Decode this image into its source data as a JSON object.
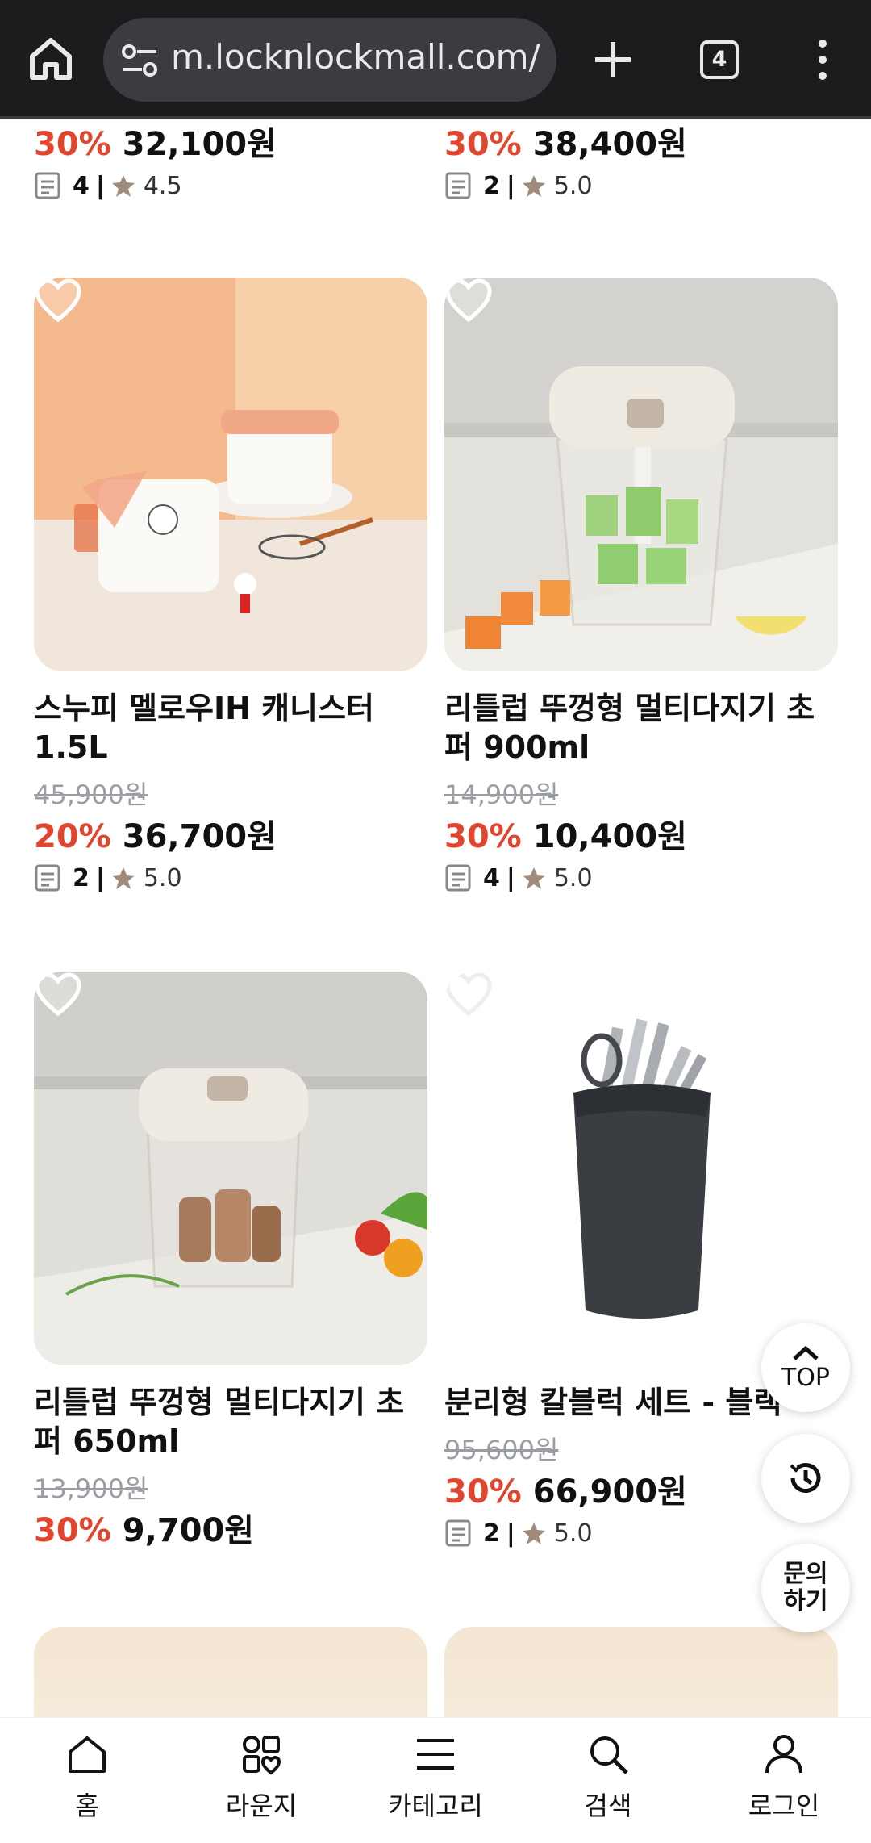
{
  "browser": {
    "url": "m.locknlockmall.com/",
    "tab_count": "4"
  },
  "top_partial": [
    {
      "discount": "30%",
      "price": "32,100원",
      "reviews": "4",
      "rating": "4.5"
    },
    {
      "discount": "30%",
      "price": "38,400원",
      "reviews": "2",
      "rating": "5.0"
    }
  ],
  "products": [
    {
      "name": "스누피 멜로우IH 캐니스터 1.5L",
      "original_price": "45,900원",
      "discount": "20%",
      "price": "36,700원",
      "reviews": "2",
      "rating": "5.0"
    },
    {
      "name": "리틀럽 뚜껑형 멀티다지기 초퍼 900ml",
      "original_price": "14,900원",
      "discount": "30%",
      "price": "10,400원",
      "reviews": "4",
      "rating": "5.0"
    },
    {
      "name": "리틀럽 뚜껑형 멀티다지기 초퍼 650ml",
      "original_price": "13,900원",
      "discount": "30%",
      "price": "9,700원"
    },
    {
      "name": "분리형 칼블럭 세트 - 블랙",
      "original_price": "95,600원",
      "discount": "30%",
      "price": "66,900원",
      "reviews": "2",
      "rating": "5.0"
    }
  ],
  "floating": {
    "top_label": "TOP",
    "ask_label": "문의하기"
  },
  "bottom_nav": [
    {
      "label": "홈",
      "icon": "home-icon"
    },
    {
      "label": "라운지",
      "icon": "lounge-icon"
    },
    {
      "label": "카테고리",
      "icon": "menu-icon"
    },
    {
      "label": "검색",
      "icon": "search-icon"
    },
    {
      "label": "로그인",
      "icon": "user-icon"
    }
  ],
  "colors": {
    "discount": "#e2452e",
    "browser_bg": "#1b1c1e",
    "star": "#a08a7a"
  }
}
